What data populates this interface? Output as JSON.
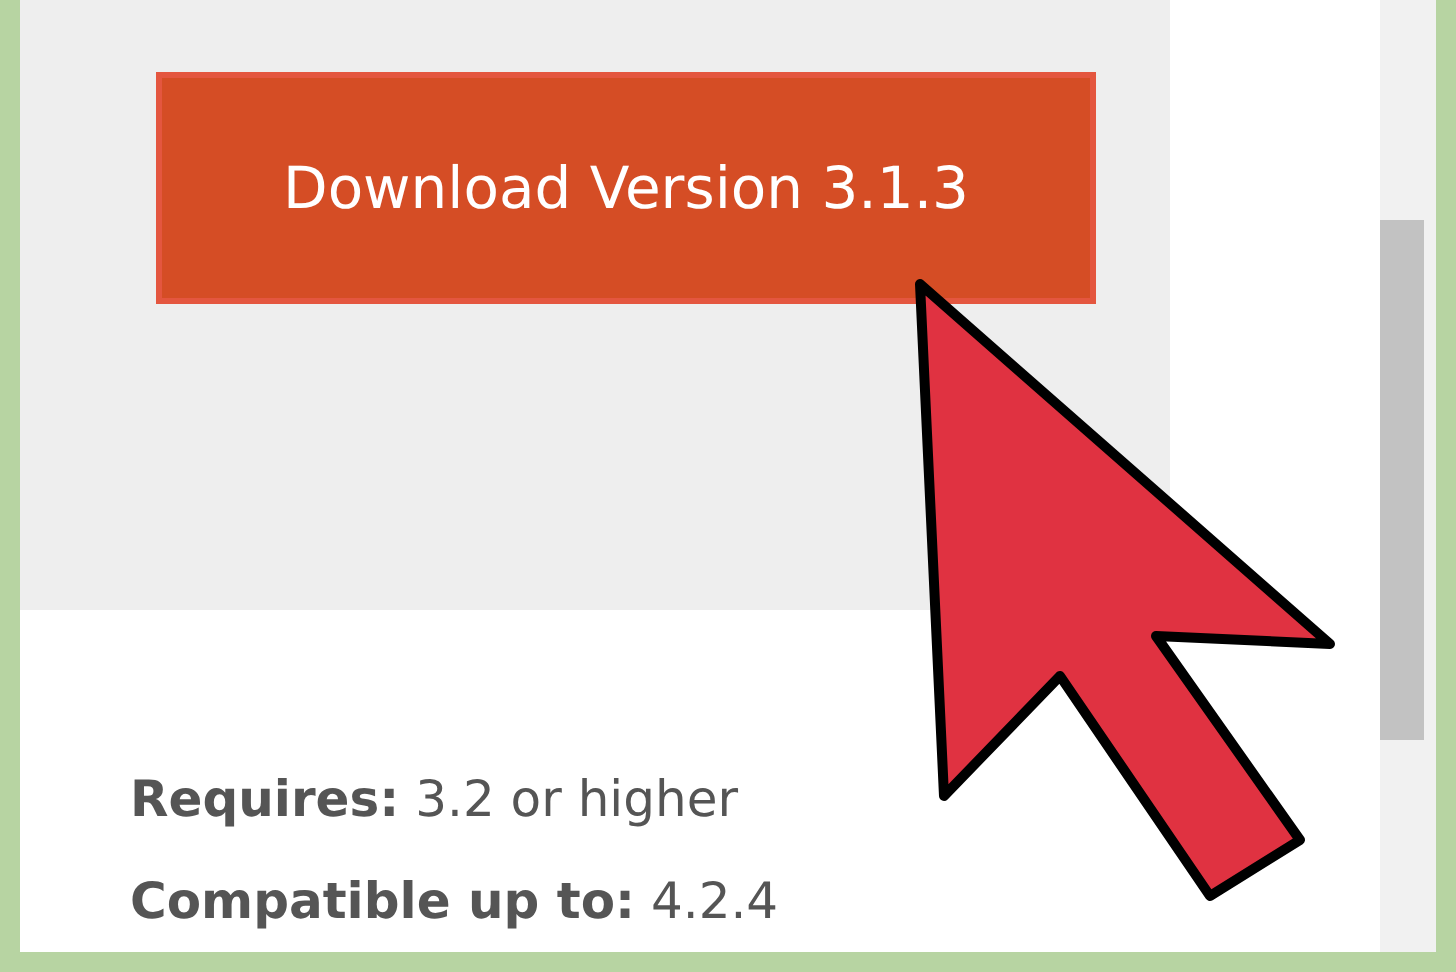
{
  "download_button": {
    "label": "Download Version 3.1.3"
  },
  "specs": [
    {
      "label": "Requires:",
      "value": "3.2 or higher"
    },
    {
      "label": "Compatible up to:",
      "value": "4.2.4"
    }
  ]
}
